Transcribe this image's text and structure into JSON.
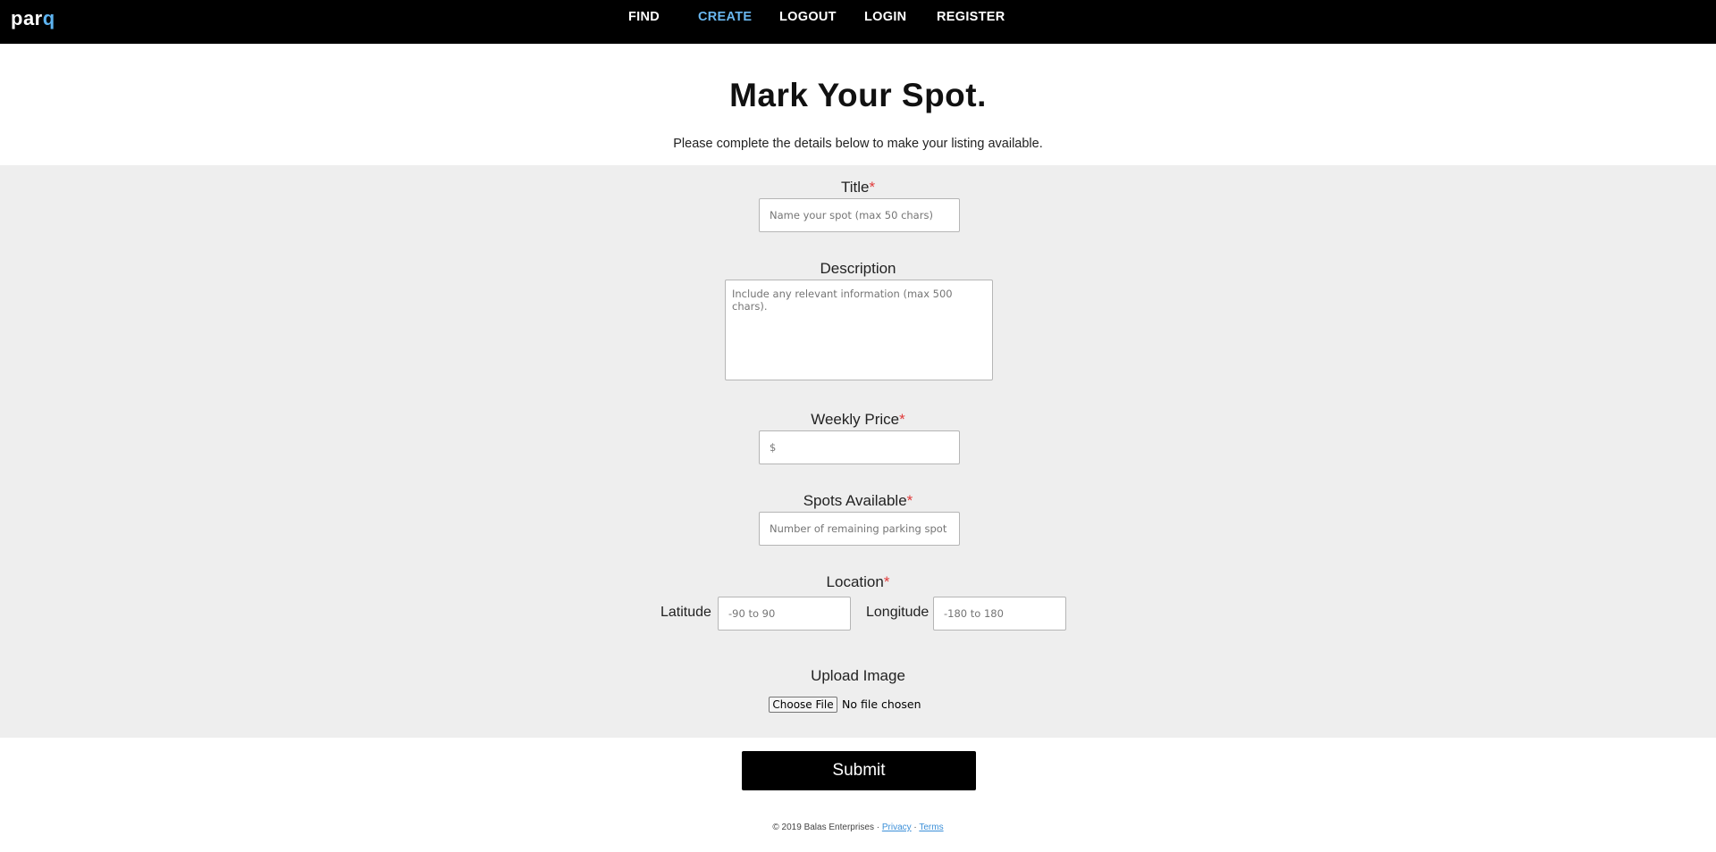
{
  "header": {
    "logo_main": "par",
    "logo_accent": "q",
    "nav": [
      {
        "label": "FIND"
      },
      {
        "label": "CREATE",
        "active": true
      },
      {
        "label": "LOGOUT"
      },
      {
        "label": "LOGIN"
      },
      {
        "label": "REGISTER"
      }
    ],
    "accent_color": "#6ab7ef"
  },
  "hero": {
    "title": "Mark Your Spot.",
    "subtitle": "Please complete the details below to make your listing available."
  },
  "form": {
    "required_marker": "*",
    "title": {
      "label": "Title",
      "placeholder": "Name your spot (max 50 chars)",
      "value": ""
    },
    "description": {
      "label": "Description",
      "placeholder": "Include any relevant information (max 500 chars).",
      "value": ""
    },
    "weekly_price": {
      "label": "Weekly Price",
      "placeholder": "$",
      "value": ""
    },
    "spots_available": {
      "label": "Spots Available",
      "placeholder": "Number of remaining parking spot",
      "value": ""
    },
    "location": {
      "label": "Location",
      "latitude_label": "Latitude",
      "latitude_placeholder": "-90 to 90",
      "longitude_label": "Longitude",
      "longitude_placeholder": "-180 to 180"
    },
    "upload": {
      "label": "Upload Image",
      "button_label": "Choose File",
      "status": "No file chosen"
    },
    "submit_label": "Submit"
  },
  "footer": {
    "text": "© 2019 Balas Enterprises · ",
    "privacy": "Privacy",
    "separator": " · ",
    "terms": "Terms"
  }
}
